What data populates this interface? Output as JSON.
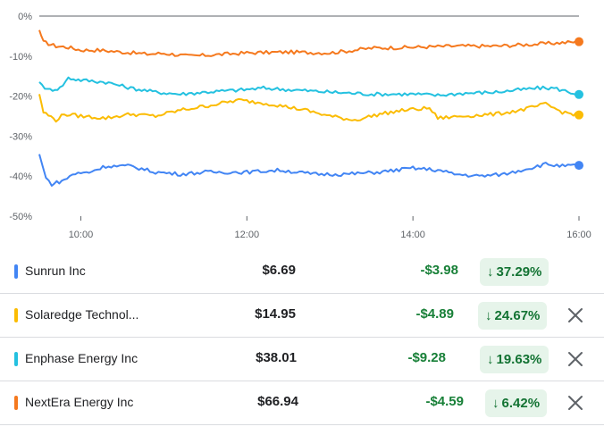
{
  "chart_data": {
    "type": "line",
    "ylabels": [
      "0%",
      "-10%",
      "-20%",
      "-30%",
      "-40%",
      "-50%"
    ],
    "yvalues": [
      0,
      -10,
      -20,
      -30,
      -40,
      -50
    ],
    "ylim": [
      -50,
      0
    ],
    "xlabels": [
      "10:00",
      "12:00",
      "14:00",
      "16:00"
    ],
    "x_hours": [
      10,
      12,
      14,
      16
    ],
    "xlim": [
      9.5,
      16
    ],
    "series": [
      {
        "name": "NextEra Energy Inc",
        "color": "#f5791e",
        "values": [
          [
            9.5,
            -3.5
          ],
          [
            9.55,
            -6.5
          ],
          [
            9.7,
            -7.5
          ],
          [
            9.85,
            -7.8
          ],
          [
            10.0,
            -8.5
          ],
          [
            10.2,
            -8.5
          ],
          [
            10.5,
            -9.0
          ],
          [
            10.8,
            -9.5
          ],
          [
            11.0,
            -9.3
          ],
          [
            11.3,
            -10.0
          ],
          [
            11.5,
            -9.8
          ],
          [
            12.0,
            -9.2
          ],
          [
            12.5,
            -9.0
          ],
          [
            13.0,
            -9.2
          ],
          [
            13.3,
            -8.5
          ],
          [
            13.5,
            -8.0
          ],
          [
            14.0,
            -7.8
          ],
          [
            14.5,
            -7.5
          ],
          [
            15.0,
            -7.5
          ],
          [
            15.5,
            -7.0
          ],
          [
            16.0,
            -6.4
          ]
        ]
      },
      {
        "name": "Enphase Energy Inc",
        "color": "#24c1e0",
        "values": [
          [
            9.5,
            -16.5
          ],
          [
            9.6,
            -18.5
          ],
          [
            9.75,
            -18.0
          ],
          [
            9.85,
            -15.5
          ],
          [
            10.0,
            -16.0
          ],
          [
            10.3,
            -16.5
          ],
          [
            10.6,
            -18.0
          ],
          [
            10.9,
            -19.0
          ],
          [
            11.2,
            -19.5
          ],
          [
            11.5,
            -19.0
          ],
          [
            11.9,
            -18.5
          ],
          [
            12.2,
            -18.0
          ],
          [
            12.6,
            -18.5
          ],
          [
            13.0,
            -19.0
          ],
          [
            13.5,
            -19.5
          ],
          [
            14.0,
            -19.5
          ],
          [
            14.3,
            -19.8
          ],
          [
            14.6,
            -19.3
          ],
          [
            15.0,
            -19.0
          ],
          [
            15.5,
            -18.0
          ],
          [
            15.7,
            -18.0
          ],
          [
            16.0,
            -19.6
          ]
        ]
      },
      {
        "name": "Solaredge Technologies Inc",
        "color": "#fbbc04",
        "values": [
          [
            9.5,
            -19.5
          ],
          [
            9.55,
            -24.0
          ],
          [
            9.7,
            -26.0
          ],
          [
            9.8,
            -24.5
          ],
          [
            10.0,
            -25.0
          ],
          [
            10.3,
            -25.5
          ],
          [
            10.6,
            -24.5
          ],
          [
            10.9,
            -25.0
          ],
          [
            11.2,
            -23.5
          ],
          [
            11.5,
            -22.5
          ],
          [
            11.9,
            -21.0
          ],
          [
            12.3,
            -22.0
          ],
          [
            12.7,
            -23.5
          ],
          [
            13.0,
            -25.0
          ],
          [
            13.3,
            -26.0
          ],
          [
            13.6,
            -24.5
          ],
          [
            13.9,
            -23.5
          ],
          [
            14.2,
            -23.0
          ],
          [
            14.3,
            -25.5
          ],
          [
            14.6,
            -25.0
          ],
          [
            15.0,
            -24.5
          ],
          [
            15.3,
            -23.5
          ],
          [
            15.6,
            -22.0
          ],
          [
            15.8,
            -24.0
          ],
          [
            16.0,
            -24.7
          ]
        ]
      },
      {
        "name": "Sunrun Inc",
        "color": "#4285f4",
        "values": [
          [
            9.5,
            -34.5
          ],
          [
            9.58,
            -40.5
          ],
          [
            9.65,
            -42.0
          ],
          [
            9.8,
            -41.0
          ],
          [
            9.9,
            -39.5
          ],
          [
            10.1,
            -39.0
          ],
          [
            10.3,
            -37.5
          ],
          [
            10.6,
            -37.5
          ],
          [
            10.9,
            -39.0
          ],
          [
            11.2,
            -39.5
          ],
          [
            11.5,
            -39.0
          ],
          [
            12.0,
            -39.0
          ],
          [
            12.4,
            -38.5
          ],
          [
            12.8,
            -39.5
          ],
          [
            13.2,
            -39.5
          ],
          [
            13.6,
            -39.0
          ],
          [
            14.0,
            -38.0
          ],
          [
            14.3,
            -38.5
          ],
          [
            14.5,
            -39.5
          ],
          [
            14.8,
            -40.0
          ],
          [
            15.1,
            -39.5
          ],
          [
            15.4,
            -38.0
          ],
          [
            15.6,
            -37.0
          ],
          [
            15.8,
            -37.5
          ],
          [
            16.0,
            -37.3
          ]
        ]
      }
    ]
  },
  "rows": [
    {
      "name": "Sunrun Inc",
      "color": "#4285f4",
      "price": "$6.69",
      "change": "-$3.98",
      "pct": "37.29%",
      "arrow": "↓",
      "removable": false
    },
    {
      "name": "Solaredge Technol...",
      "color": "#fbbc04",
      "price": "$14.95",
      "change": "-$4.89",
      "pct": "24.67%",
      "arrow": "↓",
      "removable": true
    },
    {
      "name": "Enphase Energy Inc",
      "color": "#24c1e0",
      "price": "$38.01",
      "change": "-$9.28",
      "pct": "19.63%",
      "arrow": "↓",
      "removable": true
    },
    {
      "name": "NextEra Energy Inc",
      "color": "#f5791e",
      "price": "$66.94",
      "change": "-$4.59",
      "pct": "6.42%",
      "arrow": "↓",
      "removable": true
    }
  ],
  "icons": {
    "remove": "close-icon",
    "trend": "arrow-down-icon"
  }
}
